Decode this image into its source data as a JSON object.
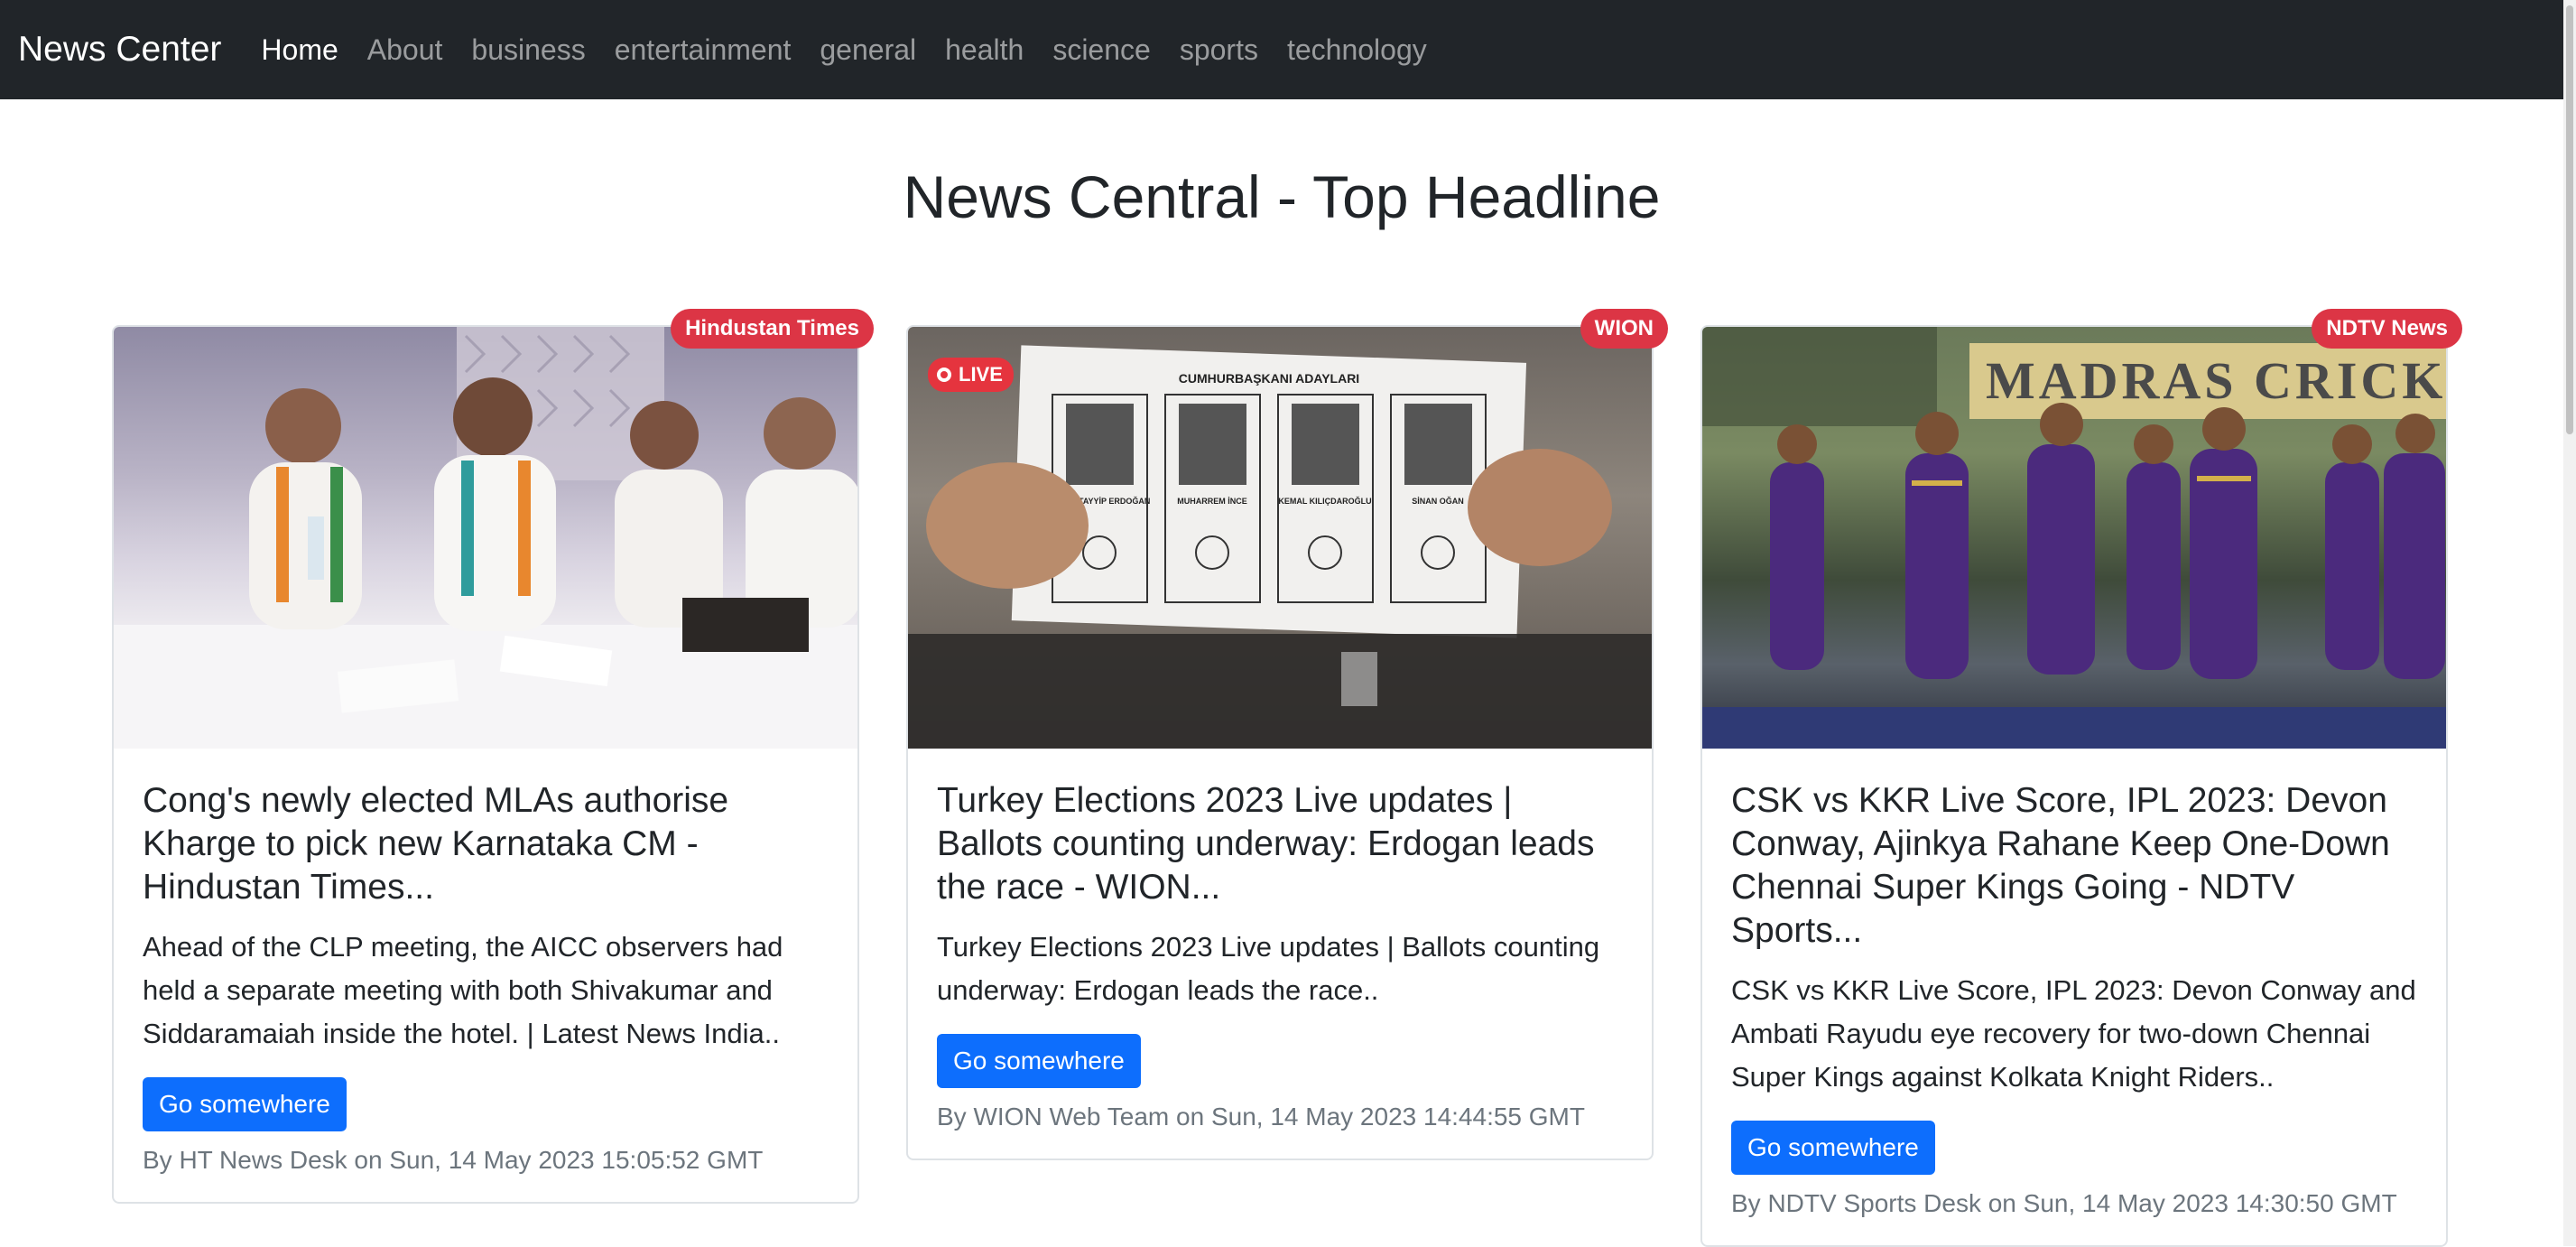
{
  "nav": {
    "brand": "News Center",
    "links": [
      {
        "label": "Home",
        "active": true
      },
      {
        "label": "About",
        "active": false
      },
      {
        "label": "business",
        "active": false
      },
      {
        "label": "entertainment",
        "active": false
      },
      {
        "label": "general",
        "active": false
      },
      {
        "label": "health",
        "active": false
      },
      {
        "label": "science",
        "active": false
      },
      {
        "label": "sports",
        "active": false
      },
      {
        "label": "technology",
        "active": false
      }
    ]
  },
  "page": {
    "title": "News Central - Top Headline"
  },
  "cards": [
    {
      "source": "Hindustan Times",
      "title": "Cong's newly elected MLAs authorise Kharge to pick new Karnataka CM - Hindustan Times...",
      "description": "Ahead of the CLP meeting, the AICC observers had held a separate meeting with both Shivakumar and Siddaramaiah inside the hotel. | Latest News India..",
      "button": "Go somewhere",
      "meta": "By HT News Desk on Sun, 14 May 2023 15:05:52 GMT"
    },
    {
      "source": "WION",
      "title": "Turkey Elections 2023 Live updates | Ballots counting underway: Erdogan leads the race - WION...",
      "description": "Turkey Elections 2023 Live updates | Ballots counting underway: Erdogan leads the race..",
      "button": "Go somewhere",
      "meta": "By WION Web Team on Sun, 14 May 2023 14:44:55 GMT",
      "image_text": {
        "live": "LIVE",
        "ballot_header": "CUMHURBAŞKANI ADAYLARI",
        "candidates": [
          "RECEP TAYYİP ERDOĞAN",
          "MUHARREM İNCE",
          "KEMAL KILIÇDAROĞLU",
          "SİNAN OĞAN"
        ]
      }
    },
    {
      "source": "NDTV News",
      "title": "CSK vs KKR Live Score, IPL 2023: Devon Conway, Ajinkya Rahane Keep One-Down Chennai Super Kings Going - NDTV Sports...",
      "description": "CSK vs KKR Live Score, IPL 2023: Devon Conway and Ambati Rayudu eye recovery for two-down Chennai Super Kings against Kolkata Knight Riders..",
      "button": "Go somewhere",
      "meta": "By NDTV Sports Desk on Sun, 14 May 2023 14:30:50 GMT",
      "image_text": {
        "sign": "MADRAS CRICK"
      }
    }
  ],
  "colors": {
    "navbar_bg": "#212529",
    "button_bg": "#0d6efd",
    "badge_bg": "#dc3545",
    "muted_text": "#6c757d"
  }
}
